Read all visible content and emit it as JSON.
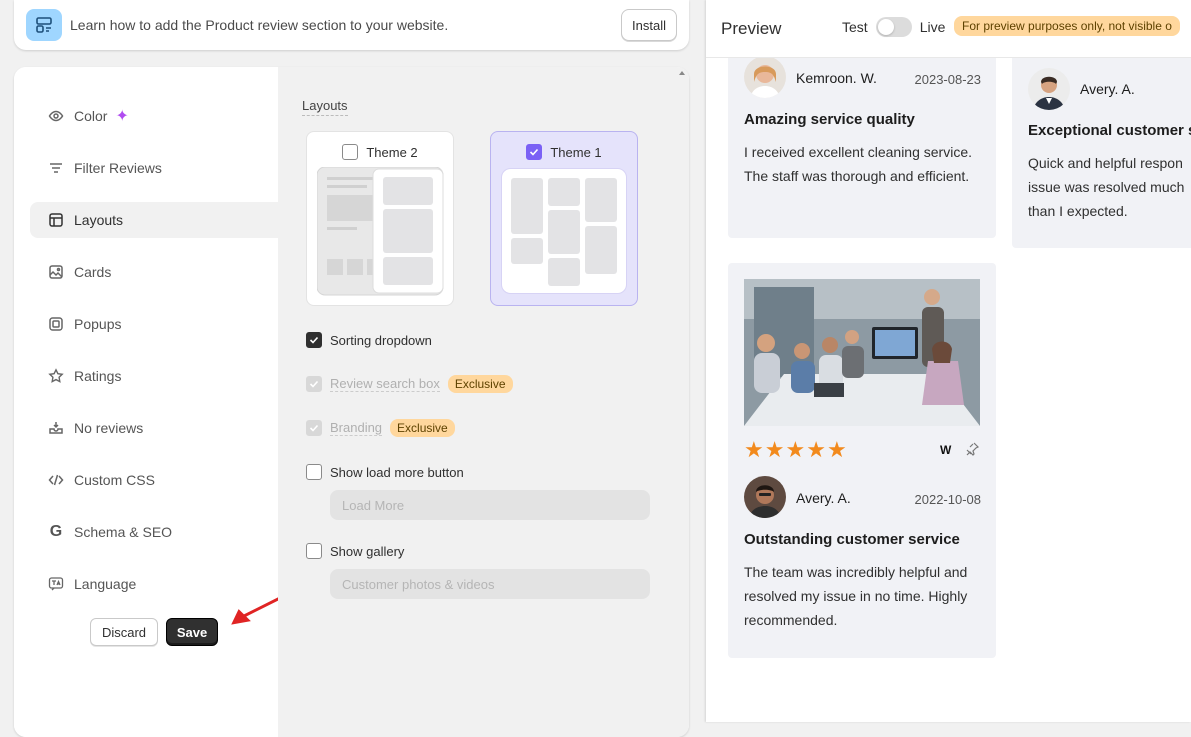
{
  "banner": {
    "text": "Learn how to add the Product review section to your website.",
    "install_label": "Install",
    "icon": "layout-block-icon"
  },
  "sidebar": {
    "items": [
      {
        "label": "Color",
        "icon": "eye-icon"
      },
      {
        "label": "Filter Reviews",
        "icon": "filter-lines-icon"
      },
      {
        "label": "Layouts",
        "icon": "layout-icon",
        "active": true
      },
      {
        "label": "Cards",
        "icon": "image-card-icon"
      },
      {
        "label": "Popups",
        "icon": "popup-icon"
      },
      {
        "label": "Ratings",
        "icon": "star-outline-icon"
      },
      {
        "label": "No reviews",
        "icon": "inbox-icon"
      },
      {
        "label": "Custom CSS",
        "icon": "code-icon"
      },
      {
        "label": "Schema & SEO",
        "icon": "google-g-icon"
      },
      {
        "label": "Language",
        "icon": "translate-icon"
      }
    ],
    "discard_label": "Discard",
    "save_label": "Save"
  },
  "layouts": {
    "title": "Layouts",
    "themes": [
      {
        "label": "Theme 2",
        "checked": false
      },
      {
        "label": "Theme 1",
        "checked": true
      }
    ],
    "options": {
      "sorting": {
        "label": "Sorting dropdown",
        "checked": true
      },
      "search": {
        "label": "Review search box",
        "badge": "Exclusive",
        "disabled": true
      },
      "branding": {
        "label": "Branding",
        "badge": "Exclusive",
        "disabled": true
      },
      "load_more": {
        "label": "Show load more button",
        "checked": false,
        "input_placeholder": "Load More"
      },
      "gallery": {
        "label": "Show gallery",
        "checked": false,
        "input_placeholder": "Customer photos & videos"
      }
    }
  },
  "preview": {
    "title": "Preview",
    "toggle_left": "Test",
    "toggle_right": "Live",
    "note": "For preview purposes only, not visible o",
    "reviews": [
      {
        "name": "Kemroon. W.",
        "date": "2023-08-23",
        "title": "Amazing service quality",
        "body": "I received excellent cleaning service. The staff was thorough and efficient."
      },
      {
        "name": "Avery. A.",
        "date": "",
        "title": "Exceptional customer s",
        "body": "Quick and helpful respon issue was resolved much than I expected."
      },
      {
        "name": "Avery. A.",
        "date": "2022-10-08",
        "title": "Outstanding customer service",
        "body": "The team was incredibly helpful and resolved my issue in no time. Highly recommended.",
        "rating": 5
      }
    ]
  },
  "colors": {
    "accent_purple": "#7b61f5",
    "badge_bg": "#ffd79d",
    "star": "#f28a1d",
    "save_bg": "#303030",
    "arrow": "#e02424"
  }
}
